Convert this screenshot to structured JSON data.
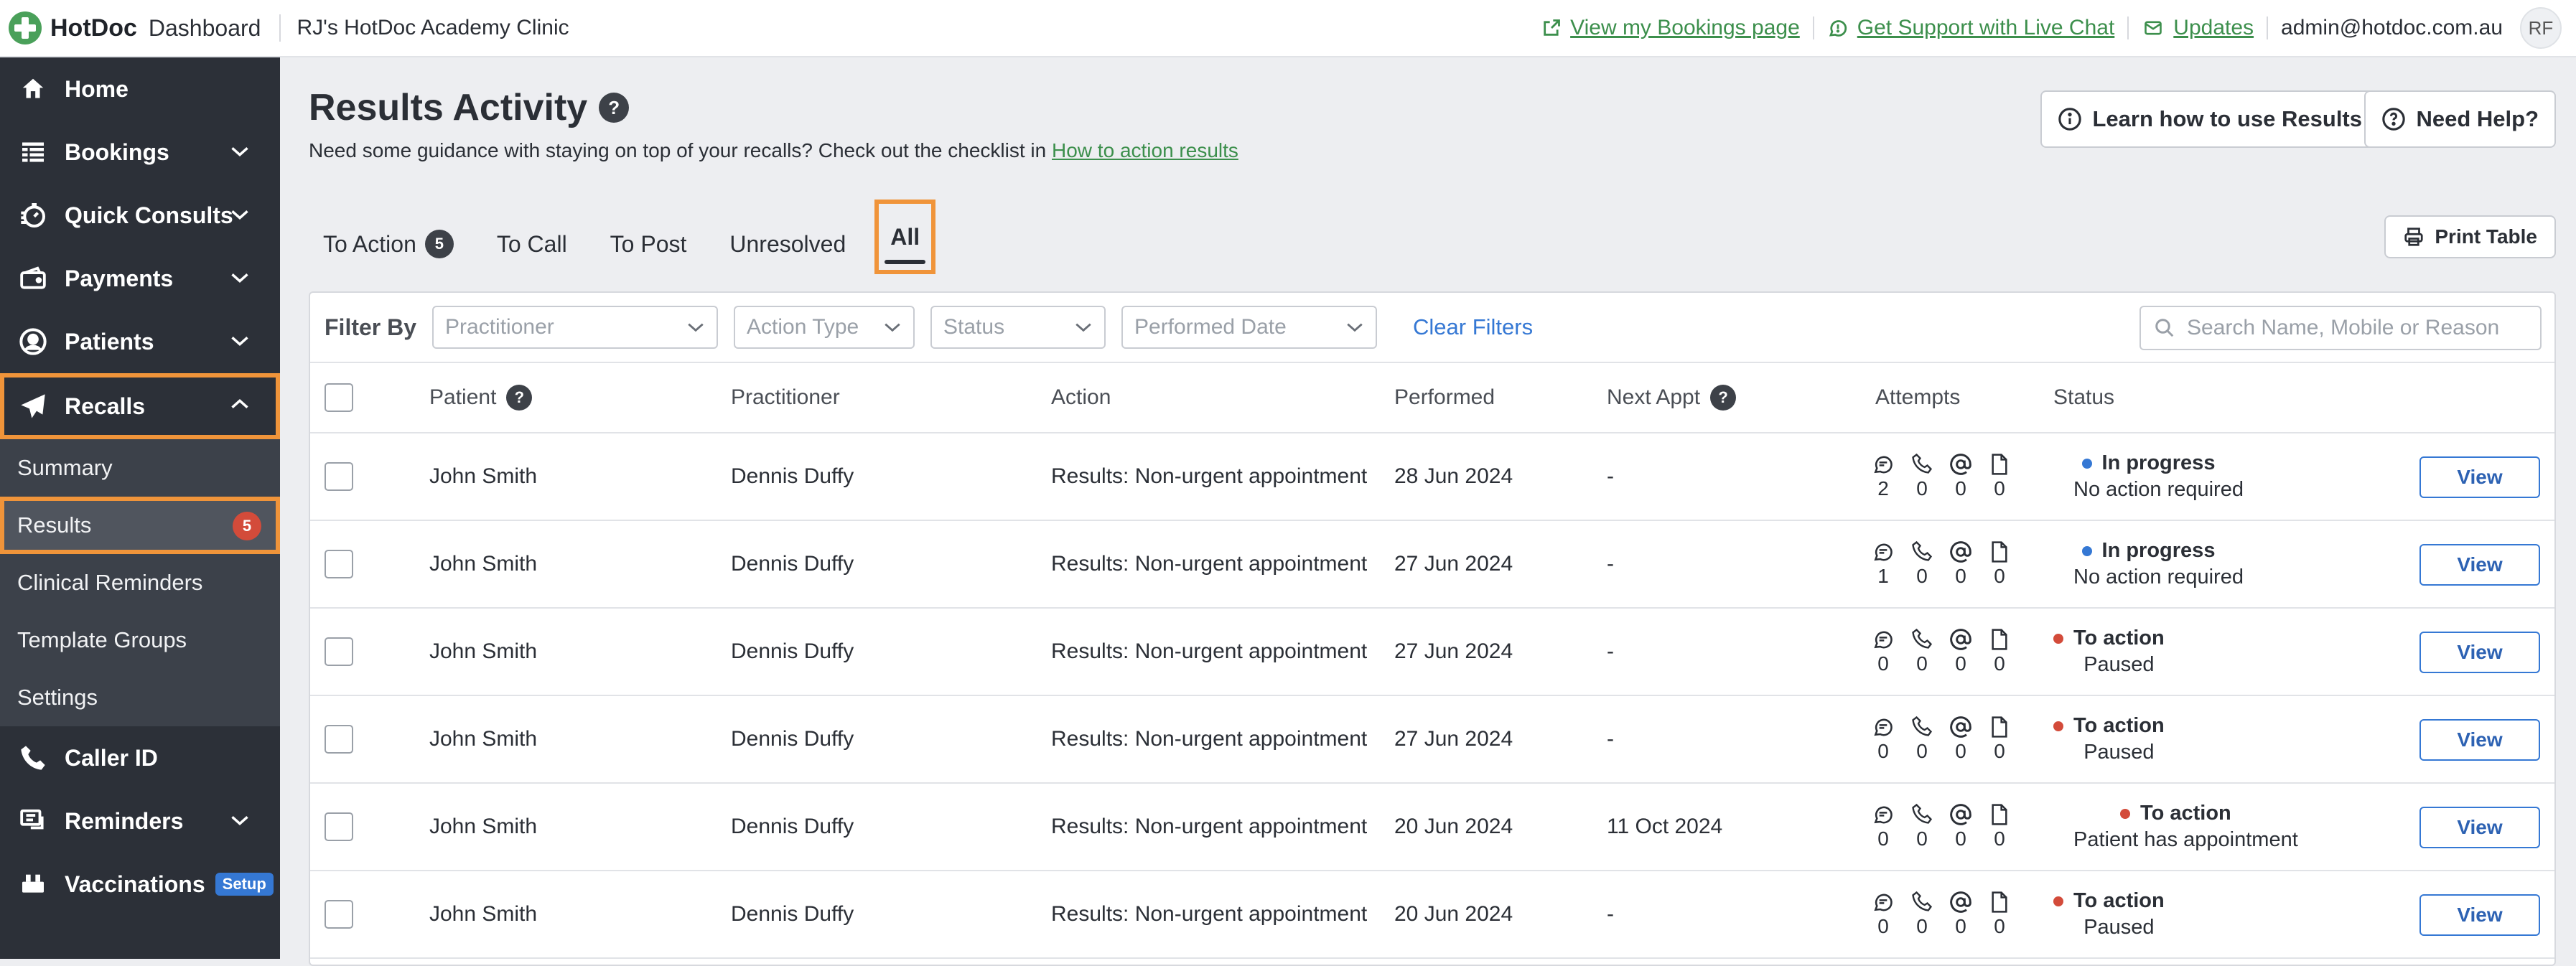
{
  "topbar": {
    "logo": "HotDoc",
    "product": "Dashboard",
    "clinic": "RJ's HotDoc Academy Clinic",
    "links": [
      {
        "label": "View my Bookings page",
        "icon": "external-link-icon"
      },
      {
        "label": "Get Support with Live Chat",
        "icon": "chat-icon"
      },
      {
        "label": "Updates",
        "icon": "mail-icon"
      }
    ],
    "user_email": "admin@hotdoc.com.au",
    "avatar_initials": "RF"
  },
  "sidebar": {
    "items": [
      {
        "label": "Home",
        "icon": "home-icon"
      },
      {
        "label": "Bookings",
        "icon": "calendar-grid-icon"
      },
      {
        "label": "Quick Consults",
        "icon": "stopwatch-icon"
      },
      {
        "label": "Payments",
        "icon": "wallet-icon"
      },
      {
        "label": "Patients",
        "icon": "user-circle-icon"
      },
      {
        "label": "Recalls",
        "icon": "paper-plane-icon"
      }
    ],
    "recalls_sub": [
      {
        "label": "Summary"
      },
      {
        "label": "Results",
        "badge": "5"
      },
      {
        "label": "Clinical Reminders"
      },
      {
        "label": "Template Groups"
      },
      {
        "label": "Settings"
      }
    ],
    "bottom_items": [
      {
        "label": "Caller ID",
        "icon": "phone-icon"
      },
      {
        "label": "Reminders",
        "icon": "message-icon"
      },
      {
        "label": "Vaccinations",
        "icon": "vaccine-icon",
        "tag": "Setup"
      }
    ]
  },
  "page": {
    "title": "Results Activity",
    "guidance": "Need some guidance with staying on top of your recalls? Check out the checklist in",
    "guidance_link": "How to action results",
    "learn_button": "Learn how to use Results",
    "help_button": "Need Help?",
    "print_button": "Print Table"
  },
  "tabs": [
    {
      "label": "To Action",
      "count": "5"
    },
    {
      "label": "To Call"
    },
    {
      "label": "To Post"
    },
    {
      "label": "Unresolved"
    },
    {
      "label": "All",
      "active": true
    }
  ],
  "filters": {
    "label": "Filter By",
    "practitioner": "Practitioner",
    "action_type": "Action Type",
    "status": "Status",
    "performed_date": "Performed Date",
    "clear": "Clear Filters",
    "search_placeholder": "Search Name, Mobile or Reason"
  },
  "table": {
    "headers": {
      "patient": "Patient",
      "practitioner": "Practitioner",
      "action": "Action",
      "performed": "Performed",
      "next_appt": "Next Appt",
      "attempts": "Attempts",
      "status": "Status"
    },
    "view_label": "View",
    "status_colors": {
      "In progress": "#3578d4",
      "To action": "#d34b3a"
    },
    "rows": [
      {
        "patient": "John Smith",
        "practitioner": "Dennis Duffy",
        "action": "Results: Non-urgent appointment",
        "performed": "28 Jun 2024",
        "next_appt": "-",
        "attempts": [
          "2",
          "0",
          "0",
          "0"
        ],
        "status": "In progress",
        "status_sub": "No action required"
      },
      {
        "patient": "John Smith",
        "practitioner": "Dennis Duffy",
        "action": "Results: Non-urgent appointment",
        "performed": "27 Jun 2024",
        "next_appt": "-",
        "attempts": [
          "1",
          "0",
          "0",
          "0"
        ],
        "status": "In progress",
        "status_sub": "No action required"
      },
      {
        "patient": "John Smith",
        "practitioner": "Dennis Duffy",
        "action": "Results: Non-urgent appointment",
        "performed": "27 Jun 2024",
        "next_appt": "-",
        "attempts": [
          "0",
          "0",
          "0",
          "0"
        ],
        "status": "To action",
        "status_sub": "Paused"
      },
      {
        "patient": "John Smith",
        "practitioner": "Dennis Duffy",
        "action": "Results: Non-urgent appointment",
        "performed": "27 Jun 2024",
        "next_appt": "-",
        "attempts": [
          "0",
          "0",
          "0",
          "0"
        ],
        "status": "To action",
        "status_sub": "Paused"
      },
      {
        "patient": "John Smith",
        "practitioner": "Dennis Duffy",
        "action": "Results: Non-urgent appointment",
        "performed": "20 Jun 2024",
        "next_appt": "11 Oct 2024",
        "attempts": [
          "0",
          "0",
          "0",
          "0"
        ],
        "status": "To action",
        "status_sub": "Patient has appointment"
      },
      {
        "patient": "John Smith",
        "practitioner": "Dennis Duffy",
        "action": "Results: Non-urgent appointment",
        "performed": "20 Jun 2024",
        "next_appt": "-",
        "attempts": [
          "0",
          "0",
          "0",
          "0"
        ],
        "status": "To action",
        "status_sub": "Paused"
      }
    ]
  }
}
